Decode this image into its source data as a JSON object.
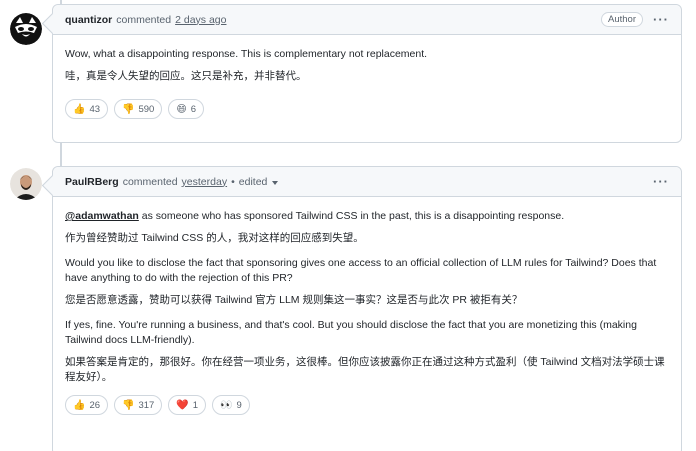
{
  "comments": [
    {
      "author": "quantizor",
      "action": "commented",
      "time": "2 days ago",
      "badge": "Author",
      "menu": "···",
      "avatar_icon": "raccoon-avatar",
      "paragraphs": [
        "Wow, what a disappointing response. This is complementary not replacement.",
        "哇，真是令人失望的回应。这只是补充，并非替代。"
      ],
      "reactions": [
        {
          "emoji": "👍",
          "icon": "thumbs-up-icon",
          "count": "43"
        },
        {
          "emoji": "👎",
          "icon": "thumbs-down-icon",
          "count": "590"
        },
        {
          "emoji": "😄",
          "icon": "laugh-icon",
          "count": "6"
        }
      ]
    },
    {
      "author": "PaulRBerg",
      "action": "commented",
      "time": "yesterday",
      "separator": "•",
      "edited": "edited",
      "menu": "···",
      "avatar_icon": "person-avatar",
      "mention": "@adamwathan",
      "p1_rest": " as someone who has sponsored Tailwind CSS in the past, this is a disappointing response.",
      "paragraphs": [
        "作为曾经赞助过 Tailwind CSS 的人，我对这样的回应感到失望。",
        "Would you like to disclose the fact that sponsoring gives one access to an official collection of LLM rules for Tailwind? Does that have anything to do with the rejection of this PR?",
        "您是否愿意透露，赞助可以获得 Tailwind 官方 LLM 规则集这一事实？这是否与此次 PR 被拒有关？",
        "If yes, fine. You're running a business, and that's cool. But you should disclose the fact that you are monetizing this (making Tailwind docs LLM-friendly).",
        "如果答案是肯定的，那很好。你在经营一项业务，这很棒。但你应该披露你正在通过这种方式盈利（使 Tailwind 文档对法学硕士课程友好）。"
      ],
      "reactions": [
        {
          "emoji": "👍",
          "icon": "thumbs-up-icon",
          "count": "26"
        },
        {
          "emoji": "👎",
          "icon": "thumbs-down-icon",
          "count": "317"
        },
        {
          "emoji": "❤️",
          "icon": "heart-icon",
          "count": "1"
        },
        {
          "emoji": "👀",
          "icon": "eyes-icon",
          "count": "9"
        }
      ]
    }
  ]
}
